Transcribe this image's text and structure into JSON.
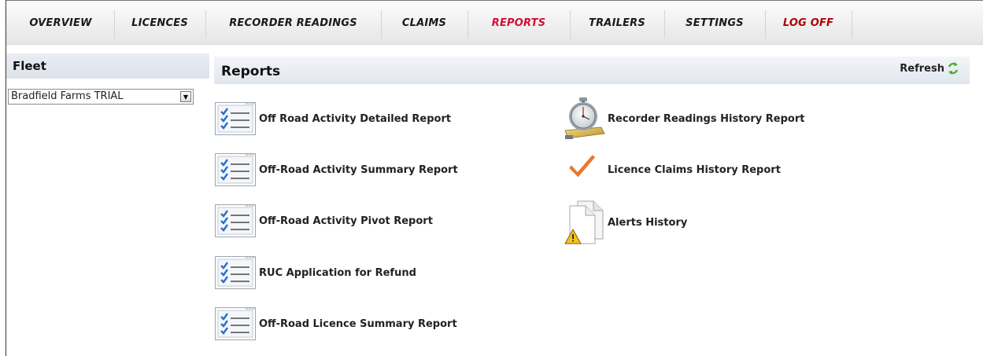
{
  "nav": {
    "items": [
      {
        "label": "OVERVIEW"
      },
      {
        "label": "LICENCES"
      },
      {
        "label": "RECORDER READINGS"
      },
      {
        "label": "CLAIMS"
      },
      {
        "label": "REPORTS",
        "active": true
      },
      {
        "label": "TRAILERS"
      },
      {
        "label": "SETTINGS"
      },
      {
        "label": "LOG OFF"
      }
    ]
  },
  "sidebar": {
    "title": "Fleet",
    "fleet_select": {
      "selected": "Bradfield Farms TRIAL"
    }
  },
  "reports": {
    "title": "Reports",
    "refresh_label": "Refresh",
    "left_items": [
      {
        "label": "Off Road Activity Detailed Report",
        "icon": "checklist-icon"
      },
      {
        "label": "Off-Road Activity Summary Report",
        "icon": "checklist-icon"
      },
      {
        "label": "Off-Road Activity Pivot Report",
        "icon": "checklist-icon"
      },
      {
        "label": "RUC Application for Refund",
        "icon": "checklist-icon"
      },
      {
        "label": "Off-Road Licence Summary Report",
        "icon": "checklist-icon"
      }
    ],
    "right_items": [
      {
        "label": "Recorder Readings History Report",
        "icon": "stopwatch-icon"
      },
      {
        "label": "Licence Claims History Report",
        "icon": "checkmark-icon"
      },
      {
        "label": "Alerts History",
        "icon": "warning-document-icon"
      }
    ]
  },
  "colors": {
    "active_nav": "#d0103a",
    "logoff": "#b00000",
    "refresh_icon": "#4caf2e",
    "check_orange": "#f07a2a"
  }
}
